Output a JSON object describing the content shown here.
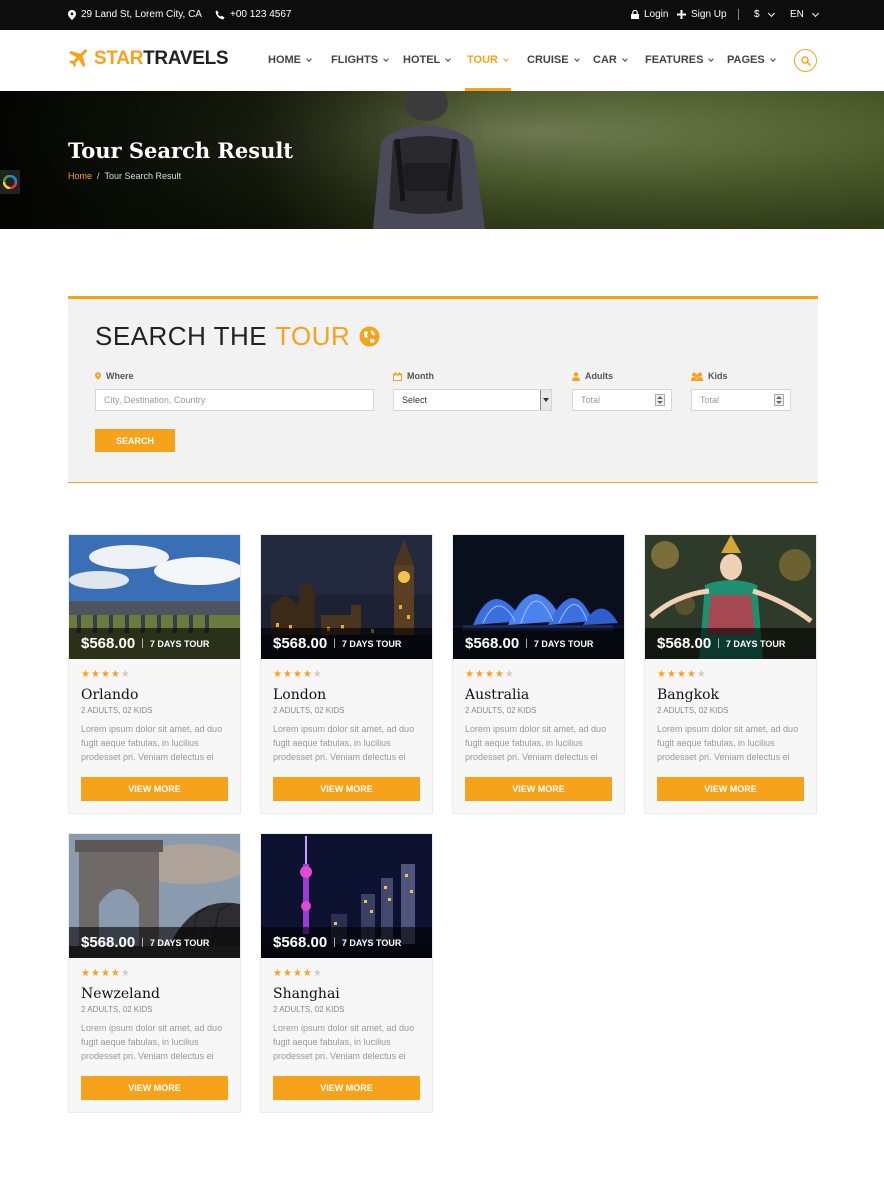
{
  "topbar": {
    "address": "29 Land St, Lorem City, CA",
    "phone": "+00 123 4567",
    "login": "Login",
    "signup": "Sign Up",
    "currency": "$",
    "language": "EN"
  },
  "header": {
    "logo_a": "STAR",
    "logo_b": "TRAVELS",
    "nav": [
      "HOME",
      "FLIGHTS",
      "HOTEL",
      "TOUR",
      "CRUISE",
      "CAR",
      "FEATURES",
      "PAGES"
    ],
    "active_nav": "TOUR",
    "accent": "#f7a21b"
  },
  "hero": {
    "title": "Tour Search Result",
    "breadcrumb_home": "Home",
    "breadcrumb_sep": "/",
    "breadcrumb_current": "Tour Search Result"
  },
  "search": {
    "title_a": "SEARCH THE",
    "title_b": "TOUR",
    "where_label": "Where",
    "where_placeholder": "City, Destination, Country",
    "month_label": "Month",
    "month_value": "Select",
    "adults_label": "Adults",
    "adults_placeholder": "Total",
    "kids_label": "Kids",
    "kids_placeholder": "Total",
    "button": "SEARCH"
  },
  "tours": [
    {
      "name": "Orlando",
      "price": "$568.00",
      "sep": "|",
      "duration": "7 DAYS TOUR",
      "rating": 4,
      "meta": "2 ADULTS, 02 KIDS",
      "description": "Lorem ipsum dolor sit amet, ad duo fugit aeque fabulas, in lucilius prodesset pri. Veniam delectus ei",
      "button": "VIEW MORE",
      "image": "aqueduct-sky"
    },
    {
      "name": "London",
      "price": "$568.00",
      "sep": "|",
      "duration": "7 DAYS TOUR",
      "rating": 4,
      "meta": "2 ADULTS, 02 KIDS",
      "description": "Lorem ipsum dolor sit amet, ad duo fugit aeque fabulas, in lucilius prodesset pri. Veniam delectus ei",
      "button": "VIEW MORE",
      "image": "big-ben-night"
    },
    {
      "name": "Australia",
      "price": "$568.00",
      "sep": "|",
      "duration": "7 DAYS TOUR",
      "rating": 4,
      "meta": "2 ADULTS, 02 KIDS",
      "description": "Lorem ipsum dolor sit amet, ad duo fugit aeque fabulas, in lucilius prodesset pri. Veniam delectus ei",
      "button": "VIEW MORE",
      "image": "opera-house-night"
    },
    {
      "name": "Bangkok",
      "price": "$568.00",
      "sep": "|",
      "duration": "7 DAYS TOUR",
      "rating": 4,
      "meta": "2 ADULTS, 02 KIDS",
      "description": "Lorem ipsum dolor sit amet, ad duo fugit aeque fabulas, in lucilius prodesset pri. Veniam delectus ei",
      "button": "VIEW MORE",
      "image": "thai-dancer"
    },
    {
      "name": "Newzeland",
      "price": "$568.00",
      "sep": "|",
      "duration": "7 DAYS TOUR",
      "rating": 4,
      "meta": "2 ADULTS, 02 KIDS",
      "description": "Lorem ipsum dolor sit amet, ad duo fugit aeque fabulas, in lucilius prodesset pri. Veniam delectus ei",
      "button": "VIEW MORE",
      "image": "stone-arch"
    },
    {
      "name": "Shanghai",
      "price": "$568.00",
      "sep": "|",
      "duration": "7 DAYS TOUR",
      "rating": 4,
      "meta": "2 ADULTS, 02 KIDS",
      "description": "Lorem ipsum dolor sit amet, ad duo fugit aeque fabulas, in lucilius prodesset pri. Veniam delectus ei",
      "button": "VIEW MORE",
      "image": "city-tower-night"
    }
  ]
}
